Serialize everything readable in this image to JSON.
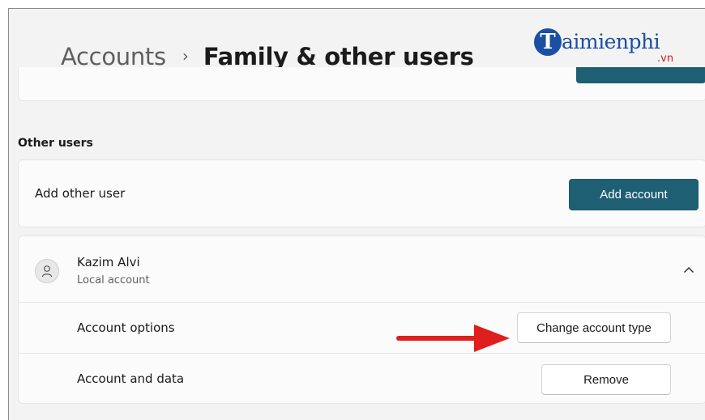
{
  "breadcrumb": {
    "parent": "Accounts",
    "separator": "›",
    "current": "Family & other users"
  },
  "watermark": {
    "initial": "T",
    "text": "aimienphi",
    "tld": ".vn"
  },
  "other_users": {
    "section_title": "Other users",
    "add_label": "Add other user",
    "add_button": "Add account"
  },
  "user": {
    "name": "Kazim Alvi",
    "account_type": "Local account",
    "expanded": true,
    "options": [
      {
        "label": "Account options",
        "button": "Change account type"
      },
      {
        "label": "Account and data",
        "button": "Remove"
      }
    ]
  },
  "icons": {
    "avatar": "person-icon",
    "collapse": "chevron-up-icon",
    "annotation": "red-arrow-icon"
  },
  "colors": {
    "accent": "#1e5f73",
    "arrow": "#e01e1e",
    "watermark": "#1a4fa3"
  }
}
